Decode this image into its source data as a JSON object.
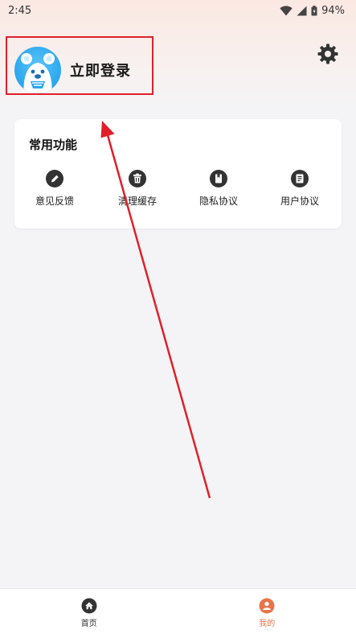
{
  "status_bar": {
    "time": "2:45",
    "battery": "94%"
  },
  "profile": {
    "login_label": "立即登录"
  },
  "card": {
    "title": "常用功能",
    "items": [
      {
        "label": "意见反馈",
        "icon": "pencil-icon"
      },
      {
        "label": "清理缓存",
        "icon": "trash-icon"
      },
      {
        "label": "隐私协议",
        "icon": "bookmark-icon"
      },
      {
        "label": "用户协议",
        "icon": "document-icon"
      }
    ]
  },
  "tabs": [
    {
      "label": "首页",
      "icon": "home-icon",
      "active": false
    },
    {
      "label": "我的",
      "icon": "user-icon",
      "active": true
    }
  ],
  "colors": {
    "accent": "#e8754a",
    "annotation": "#e0202a",
    "dark_icon": "#333333"
  }
}
